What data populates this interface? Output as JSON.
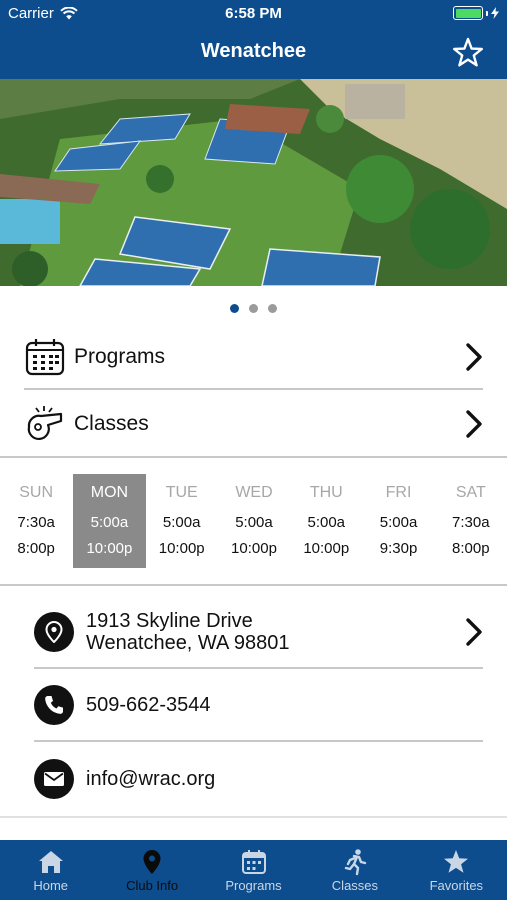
{
  "status_bar": {
    "carrier": "Carrier",
    "time": "6:58 PM"
  },
  "header": {
    "title": "Wenatchee"
  },
  "carousel": {
    "page_count": 3,
    "active_index": 0
  },
  "menu": [
    {
      "label": "Programs",
      "icon": "calendar-icon"
    },
    {
      "label": "Classes",
      "icon": "whistle-icon"
    }
  ],
  "hours": [
    {
      "day": "SUN",
      "open": "7:30a",
      "close": "8:00p"
    },
    {
      "day": "MON",
      "open": "5:00a",
      "close": "10:00p"
    },
    {
      "day": "TUE",
      "open": "5:00a",
      "close": "10:00p"
    },
    {
      "day": "WED",
      "open": "5:00a",
      "close": "10:00p"
    },
    {
      "day": "THU",
      "open": "5:00a",
      "close": "10:00p"
    },
    {
      "day": "FRI",
      "open": "5:00a",
      "close": "9:30p"
    },
    {
      "day": "SAT",
      "open": "7:30a",
      "close": "8:00p"
    }
  ],
  "contact": {
    "address_line1": "1913 Skyline Drive",
    "address_line2": "Wenatchee, WA 98801",
    "phone": "509-662-3544",
    "email": "info@wrac.org"
  },
  "tabs": [
    {
      "label": "Home",
      "icon": "home-icon"
    },
    {
      "label": "Club Info",
      "icon": "location-pin-icon"
    },
    {
      "label": "Programs",
      "icon": "calendar-icon"
    },
    {
      "label": "Classes",
      "icon": "runner-icon"
    },
    {
      "label": "Favorites",
      "icon": "star-icon"
    }
  ],
  "colors": {
    "brand": "#0d4d8e",
    "selected_day": "#8a8a8a",
    "active_dot": "#0d4d8e",
    "battery": "#4cd964"
  }
}
